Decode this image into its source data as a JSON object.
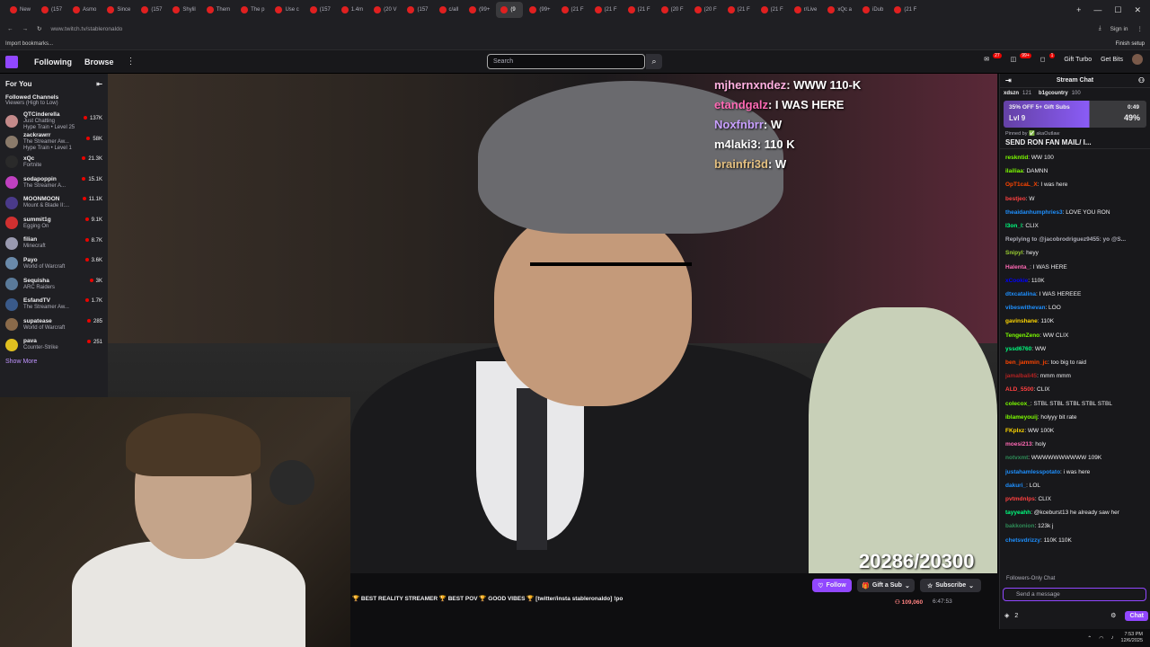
{
  "browser": {
    "tabs": [
      {
        "label": "New"
      },
      {
        "label": "(157"
      },
      {
        "label": "Asmo"
      },
      {
        "label": "Since"
      },
      {
        "label": "(157"
      },
      {
        "label": "Shylil"
      },
      {
        "label": "Them"
      },
      {
        "label": "The p"
      },
      {
        "label": "Use c"
      },
      {
        "label": "(157"
      },
      {
        "label": "1.4m"
      },
      {
        "label": "(20 V"
      },
      {
        "label": "(157"
      },
      {
        "label": "c/all"
      },
      {
        "label": "(99+"
      },
      {
        "label": "(9"
      },
      {
        "label": "(99+"
      },
      {
        "label": "(21 F"
      },
      {
        "label": "(21 F"
      },
      {
        "label": "(21 F"
      },
      {
        "label": "(20 F"
      },
      {
        "label": "(20 F"
      },
      {
        "label": "(21 F"
      },
      {
        "label": "(21 F"
      },
      {
        "label": "r/Live"
      },
      {
        "label": "xQc a"
      },
      {
        "label": "iDub"
      },
      {
        "label": "(21 F"
      }
    ],
    "active_tab_index": 15,
    "url": "www.twitch.tv/stableronaldo",
    "sign_in": "Sign in",
    "bookmarks_import": "Import bookmarks...",
    "finish_setup": "Finish setup"
  },
  "nav": {
    "following": "Following",
    "browse": "Browse",
    "search_placeholder": "Search",
    "notif_badge_1": "27",
    "notif_badge_2": "99+",
    "notif_badge_3": "1",
    "gift_turbo": "Gift Turbo",
    "get_bits": "Get Bits"
  },
  "sidebar": {
    "title": "For You",
    "section": "Followed Channels",
    "sort": "Viewers (High to Low)",
    "channels": [
      {
        "name": "QTCinderella",
        "game": "Just Chatting",
        "sub": "Hype Train • Level 25",
        "viewers": "137K",
        "color": "#c48a8a"
      },
      {
        "name": "zackrawrr",
        "game": "The Streamer Aw...",
        "sub": "Hype Train • Level 1",
        "viewers": "58K",
        "color": "#8a7a6a"
      },
      {
        "name": "xQc",
        "game": "Fortnite",
        "sub": "",
        "viewers": "21.3K",
        "color": "#2a2a2a"
      },
      {
        "name": "sodapoppin",
        "game": "The Streamer A...",
        "sub": "",
        "viewers": "15.1K",
        "color": "#c040c0"
      },
      {
        "name": "MOONMOON",
        "game": "Mount & Blade II:...",
        "sub": "",
        "viewers": "11.1K",
        "color": "#4a3a8a"
      },
      {
        "name": "summit1g",
        "game": "Egging On",
        "sub": "",
        "viewers": "9.1K",
        "color": "#d03030"
      },
      {
        "name": "filian",
        "game": "Minecraft",
        "sub": "",
        "viewers": "8.7K",
        "color": "#9a9ab0"
      },
      {
        "name": "Payo",
        "game": "World of Warcraft",
        "sub": "",
        "viewers": "3.6K",
        "color": "#6a8aaa"
      },
      {
        "name": "Sequisha",
        "game": "ARC Raiders",
        "sub": "",
        "viewers": "3K",
        "color": "#5a7a9a"
      },
      {
        "name": "EsfandTV",
        "game": "The Streamer Aw...",
        "sub": "",
        "viewers": "1.7K",
        "color": "#3a5a8a"
      },
      {
        "name": "supatease",
        "game": "World of Warcraft",
        "sub": "",
        "viewers": "285",
        "color": "#8a6a4a"
      },
      {
        "name": "pava",
        "game": "Counter-Strike",
        "sub": "",
        "viewers": "251",
        "color": "#e0c020"
      }
    ],
    "show_more": "Show More"
  },
  "video": {
    "overlay": [
      {
        "user": "mjhernxndez",
        "msg": ": WWW 110-K"
      },
      {
        "user": "etandgalz",
        "msg": ": I WAS HERE"
      },
      {
        "user": "Noxfnbrr",
        "msg": ": W"
      },
      {
        "user": "m4laki3",
        "msg": ": 110 K"
      },
      {
        "user": "brainfri3d",
        "msg": ": W"
      }
    ],
    "counter": "20286/20300"
  },
  "info": {
    "title": "🏆 BEST REALITY STREAMER 🏆 BEST POV 🏆 GOOD VIBES 🏆 [twitter/insta stableronaldo] !po",
    "follow": "Follow",
    "gift_sub": "Gift a Sub",
    "subscribe": "Subscribe",
    "viewers": "109,060",
    "uptime": "6:47:53"
  },
  "chat": {
    "title": "Stream Chat",
    "gifters": [
      {
        "name": "xdszn",
        "count": "121"
      },
      {
        "name": "b1gcountry",
        "count": "100"
      }
    ],
    "hype_offer": "35% OFF 5+ Gift Subs",
    "hype_level": "Lvl 9",
    "hype_time": "0:49",
    "hype_pct": "49%",
    "pinned_by": "Pinned by ✅ akaOutlaw",
    "pinned_msg": "SEND RON FAN MAIL/ I...",
    "messages": [
      {
        "user": "reskntid",
        "text": ": WW 100",
        "color": "#7cfc00"
      },
      {
        "user": "ilailiaa",
        "text": ": DAMNN",
        "color": "#7cfc00"
      },
      {
        "user": "OpT1caL_X",
        "text": ": I was here",
        "color": "#ff4500"
      },
      {
        "user": "bestjeo",
        "text": ": W",
        "color": "#ff4040"
      },
      {
        "user": "theaidanhumphries3",
        "text": ": LOVE YOU RON",
        "color": "#1e90ff"
      },
      {
        "user": "l3on_l",
        "text": ": CLIX",
        "color": "#00ff7f"
      },
      {
        "user": "Replying to @jacobrodriguez9455: yo @S...",
        "text": "",
        "color": "#adadb8"
      },
      {
        "user": "Snipyl",
        "text": ": heyy",
        "color": "#9acd32"
      },
      {
        "user": "Halenta_",
        "text": ": I WAS HERE",
        "color": "#ff69b4"
      },
      {
        "user": "xCookie",
        "text": ": 110K",
        "color": "#0000ff"
      },
      {
        "user": "dtxcatalina",
        "text": ": I WAS HEREEE",
        "color": "#1e90ff"
      },
      {
        "user": "vibeswithevan",
        "text": ": LOO",
        "color": "#1e90ff"
      },
      {
        "user": "gavinshane",
        "text": ": 110K",
        "color": "#ffd700"
      },
      {
        "user": "TengenZeno",
        "text": ": WW CLIX",
        "color": "#7cfc00"
      },
      {
        "user": "yssd6760",
        "text": ": WW",
        "color": "#00ff7f"
      },
      {
        "user": "ben_jammin_jc",
        "text": ": too big to raid",
        "color": "#ff4500"
      },
      {
        "user": "jamalbali45",
        "text": ": mmm mmm",
        "color": "#b22222"
      },
      {
        "user": "ALD_5500",
        "text": ": CLIX",
        "color": "#ff4040"
      },
      {
        "user": "colecox_",
        "text": ": STBL STBL STBL STBL STBL",
        "color": "#7cfc00"
      },
      {
        "user": "iblameyouij",
        "text": ": holyyy bit rate",
        "color": "#7cfc00"
      },
      {
        "user": "FKplxz",
        "text": ": WW 100K",
        "color": "#ffd700"
      },
      {
        "user": "moesi213",
        "text": ": holy",
        "color": "#ff69b4"
      },
      {
        "user": "notvxmt",
        "text": ": WWWWWWWWWW 109K",
        "color": "#2e8b57"
      },
      {
        "user": "justahamlesspotato",
        "text": ": i was here",
        "color": "#1e90ff"
      },
      {
        "user": "dakuri_",
        "text": ": LOL",
        "color": "#1e90ff"
      },
      {
        "user": "pvtmdnlps",
        "text": ": CLIX",
        "color": "#ff4040"
      },
      {
        "user": "tayyeahh",
        "text": ": @kceburst13 he already saw her",
        "color": "#00ff7f"
      },
      {
        "user": "bakkonion",
        "text": ": 123k j",
        "color": "#2e8b57"
      },
      {
        "user": "chetsvdrizzy",
        "text": ": 110K 110K",
        "color": "#1e90ff"
      }
    ],
    "followers_only": "Followers-Only Chat",
    "input_placeholder": "Send a message",
    "points": "2",
    "chat_button": "Chat"
  },
  "taskbar": {
    "time": "7:53 PM",
    "date": "12/6/2025"
  }
}
